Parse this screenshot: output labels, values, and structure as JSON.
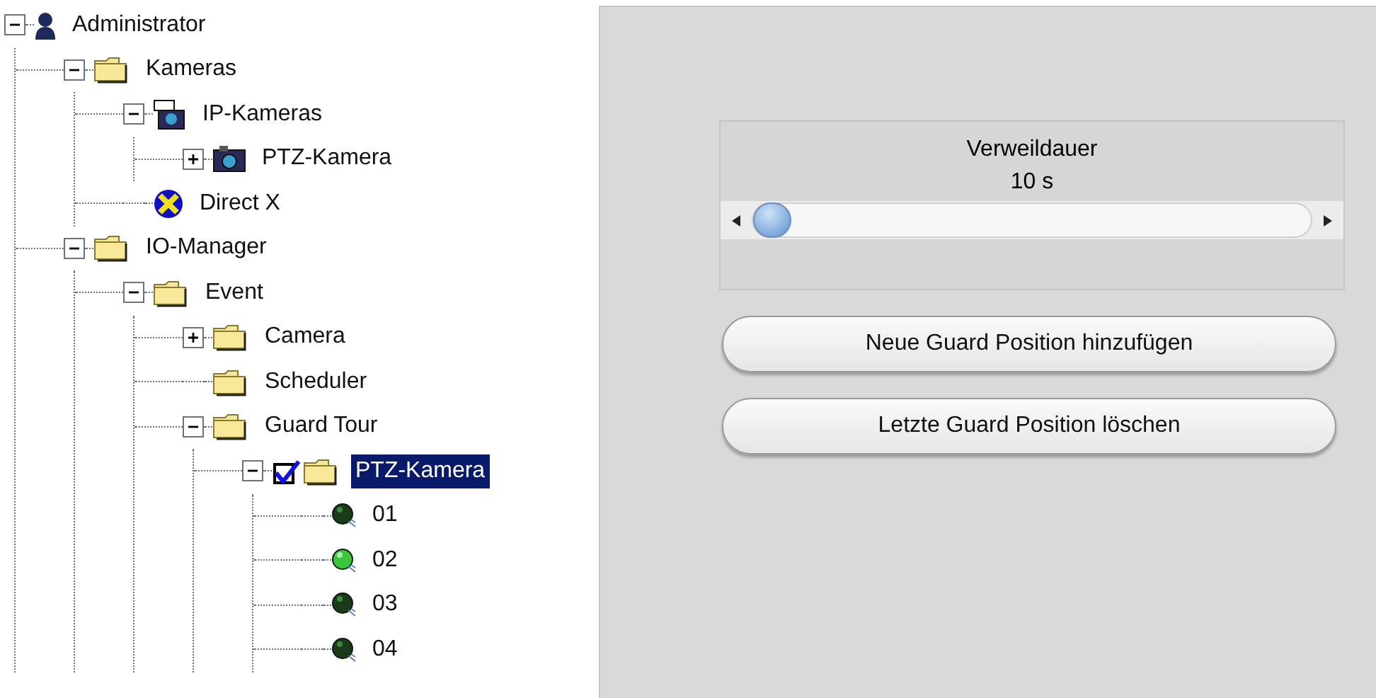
{
  "tree": [
    {
      "label": "Administrator",
      "kind": "user",
      "expanded": true,
      "selected": false,
      "children": [
        {
          "label": "Kameras",
          "kind": "folder",
          "expanded": true,
          "selected": false,
          "children": [
            {
              "label": "IP-Kameras",
              "kind": "network-camera",
              "expanded": true,
              "selected": false,
              "children": [
                {
                  "label": "PTZ-Kamera",
                  "kind": "camera",
                  "expanded": false,
                  "selected": false
                }
              ]
            },
            {
              "label": "Direct X",
              "kind": "directx",
              "selected": false
            }
          ]
        },
        {
          "label": "IO-Manager",
          "kind": "folder",
          "expanded": true,
          "selected": false,
          "children": [
            {
              "label": "Event",
              "kind": "folder",
              "expanded": true,
              "selected": false,
              "children": [
                {
                  "label": "Camera",
                  "kind": "folder",
                  "expanded": false,
                  "selected": false
                },
                {
                  "label": "Scheduler",
                  "kind": "folder",
                  "selected": false
                },
                {
                  "label": "Guard Tour",
                  "kind": "folder",
                  "expanded": true,
                  "selected": false,
                  "children": [
                    {
                      "label": "PTZ-Kamera",
                      "kind": "folder",
                      "checked": true,
                      "expanded": true,
                      "selected": true,
                      "children": [
                        {
                          "label": "01",
                          "kind": "point",
                          "active": false,
                          "selected": false
                        },
                        {
                          "label": "02",
                          "kind": "point",
                          "active": true,
                          "selected": false
                        },
                        {
                          "label": "03",
                          "kind": "point",
                          "active": false,
                          "selected": false
                        },
                        {
                          "label": "04",
                          "kind": "point",
                          "active": false,
                          "selected": false
                        }
                      ]
                    }
                  ]
                }
              ]
            }
          ]
        }
      ]
    }
  ],
  "slider": {
    "title": "Verweildauer",
    "reading": "10 s",
    "level": 0.0
  },
  "buttons": [
    "Neue Guard Position hinzufügen",
    "Letzte Guard Position löschen"
  ]
}
